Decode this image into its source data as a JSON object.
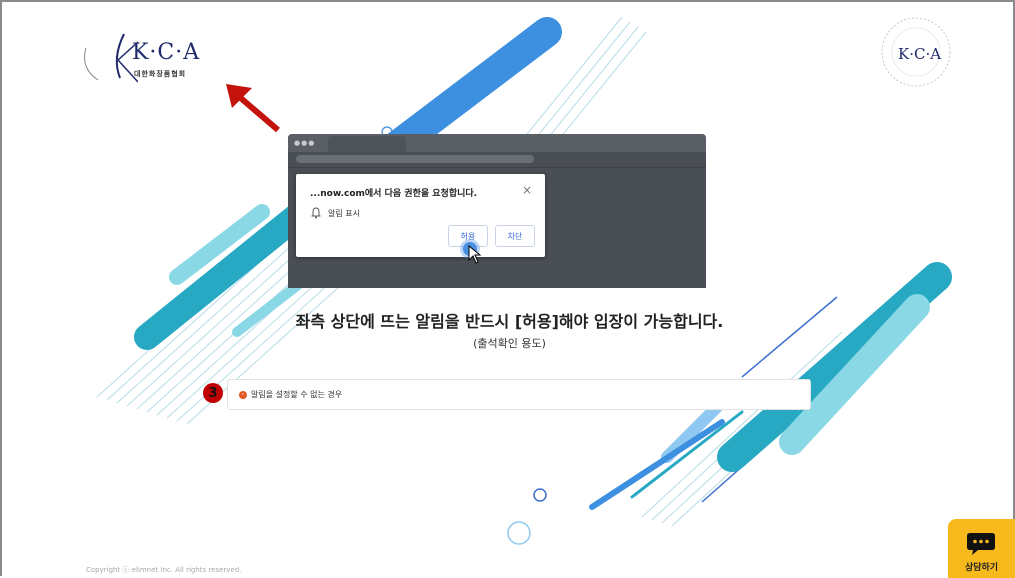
{
  "logo_left": {
    "main": "K·C·A",
    "sub": "대한화장품협회"
  },
  "logo_right": {
    "main": "K·C·A"
  },
  "dialog": {
    "title": "...now.com에서 다음 권한을 요청합니다.",
    "close": "×",
    "permission": "알림 표시",
    "allow_label": "허용",
    "block_label": "차단"
  },
  "headline": "좌측 상단에 뜨는 알림을 반드시 [허용]해야 입장이 가능합니다.",
  "subline": "(출석확인 용도)",
  "step_number": "3",
  "notice_text": "알림을 설정할 수 없는 경우",
  "copyright": "Copyright ⓒ elimnet Inc. All rights reserved.",
  "chat_label": "상담하기",
  "colors": {
    "accent_teal": "#27a9c4",
    "accent_blue": "#3d8fe0",
    "chat_yellow": "#f7b91c",
    "arrow_red": "#c4120c",
    "logo_navy": "#1f2a6b"
  }
}
